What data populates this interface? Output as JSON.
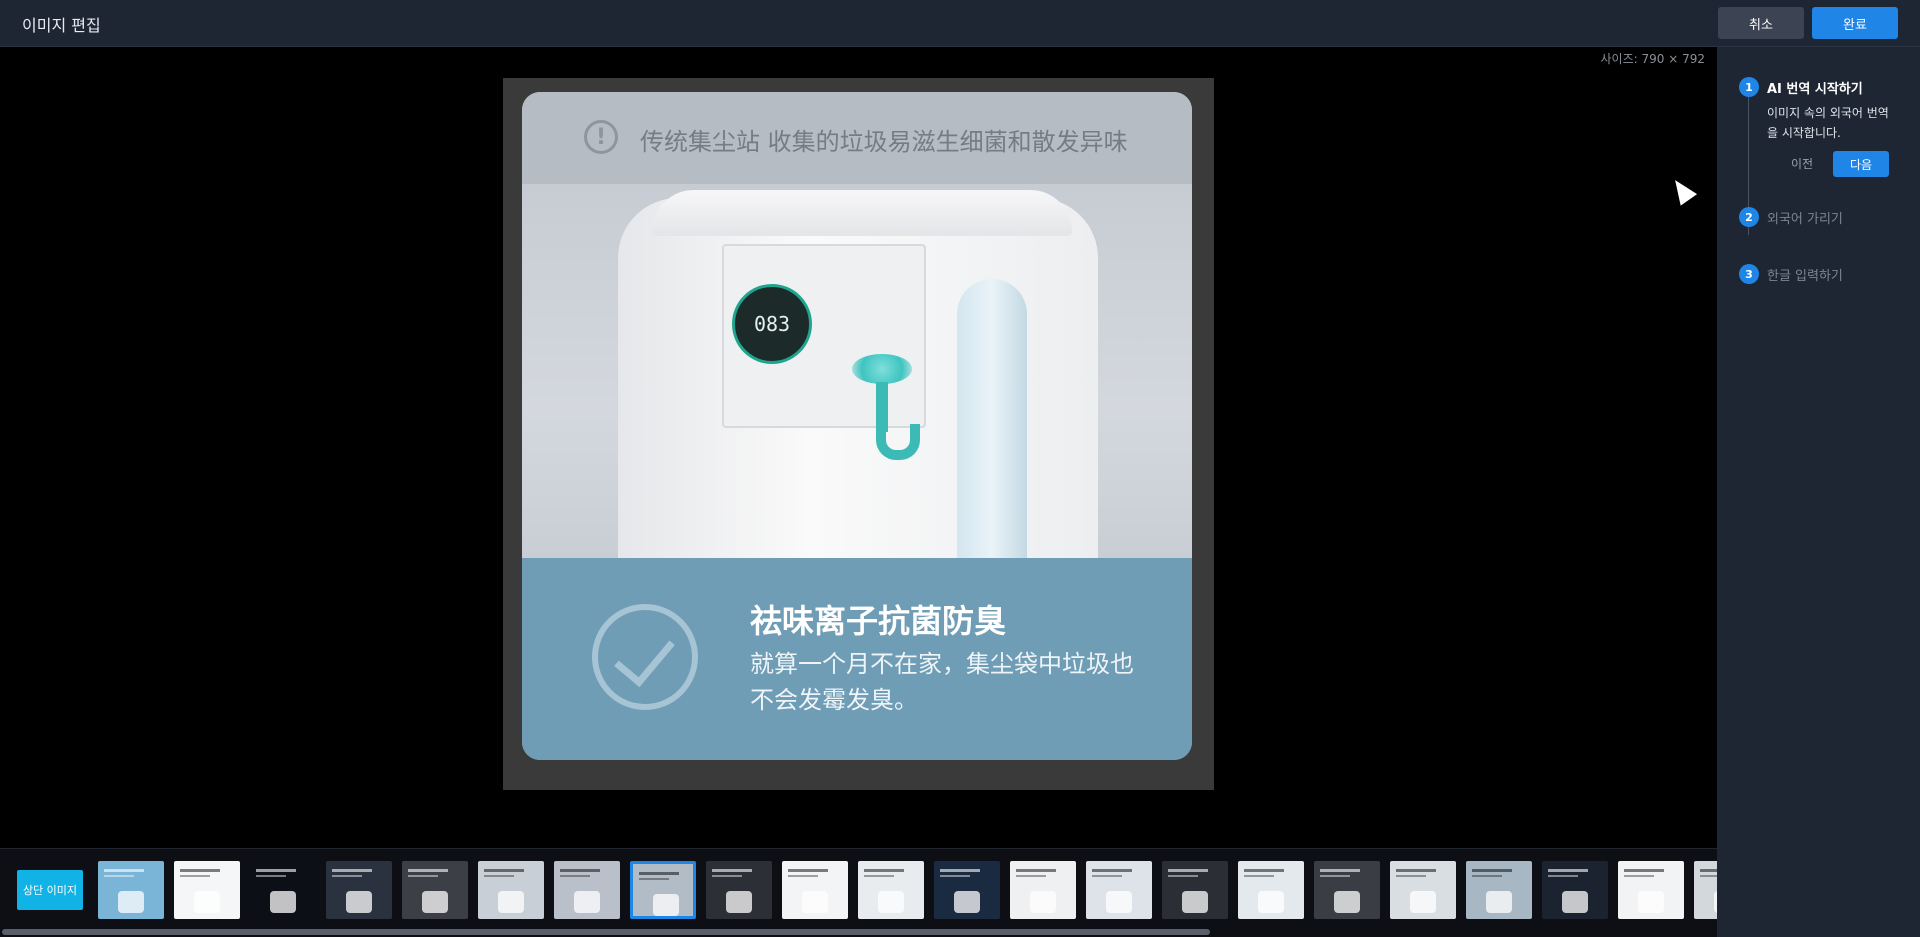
{
  "header": {
    "title": "이미지 편집",
    "cancel_label": "취소",
    "done_label": "완료"
  },
  "canvas": {
    "size_label": "사이즈: 790 × 792"
  },
  "image": {
    "top_text": "传统集尘站 收集的垃圾易滋生细菌和散发异味",
    "warn_glyph": "!",
    "display_digits": "083",
    "bottom_title": "祛味离子抗菌防臭",
    "bottom_desc": "就算一个月不在家，集尘袋中垃圾也不会发霉发臭。"
  },
  "steps": {
    "items": [
      {
        "num": "1",
        "label": "AI 번역 시작하기"
      },
      {
        "num": "2",
        "label": "외국어 가리기"
      },
      {
        "num": "3",
        "label": "한글 입력하기"
      }
    ],
    "step1_desc": "이미지 속의 외국어 번역을 시작합니다.",
    "prev_label": "이전",
    "next_label": "다음"
  },
  "strip": {
    "first_label": "상단 이미지",
    "thumbnails": [
      {
        "color": "#7ab4d6",
        "dark": false
      },
      {
        "color": "#f4f6f8",
        "dark": true
      },
      {
        "color": "#0c0f16",
        "dark": false
      },
      {
        "color": "#2a3240",
        "dark": false
      },
      {
        "color": "#3c3f46",
        "dark": false
      },
      {
        "color": "#c9cfd6",
        "dark": true
      },
      {
        "color": "#b9c0c9",
        "dark": true
      },
      {
        "color": "#b2bcc6",
        "dark": true,
        "selected": true
      },
      {
        "color": "#2c2f36",
        "dark": false
      },
      {
        "color": "#f2f4f6",
        "dark": true
      },
      {
        "color": "#e8ecef",
        "dark": true
      },
      {
        "color": "#1a2a40",
        "dark": false
      },
      {
        "color": "#eef0f2",
        "dark": true
      },
      {
        "color": "#dde3e8",
        "dark": true
      },
      {
        "color": "#2b2e35",
        "dark": false
      },
      {
        "color": "#e4e9ed",
        "dark": true
      },
      {
        "color": "#3a3d44",
        "dark": false
      },
      {
        "color": "#d9dee3",
        "dark": true
      },
      {
        "color": "#a8b7c4",
        "dark": true
      },
      {
        "color": "#1b2230",
        "dark": false
      },
      {
        "color": "#f1f3f5",
        "dark": true
      },
      {
        "color": "#d3d8dd",
        "dark": true
      }
    ]
  },
  "colors": {
    "accent": "#1f86e8",
    "header_bg": "#1e2533",
    "first_thumb": "#11b3e6"
  }
}
